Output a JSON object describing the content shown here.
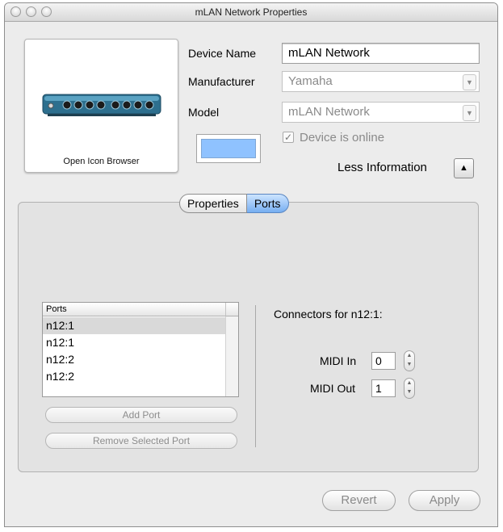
{
  "window": {
    "title": "mLAN Network Properties"
  },
  "icon_browser": {
    "caption": "Open Icon Browser",
    "icon": "mlan-device-icon"
  },
  "fields": {
    "device_name_label": "Device Name",
    "device_name_value": "mLAN Network",
    "manufacturer_label": "Manufacturer",
    "manufacturer_value": "Yamaha",
    "model_label": "Model",
    "model_value": "mLAN Network"
  },
  "color_swatch": {
    "color": "#8fc2ff"
  },
  "online": {
    "label": "Device is online",
    "checked": true
  },
  "less_info": {
    "label": "Less Information",
    "icon": "disclosure-up-icon"
  },
  "tabs": [
    {
      "label": "Properties",
      "selected": false
    },
    {
      "label": "Ports",
      "selected": true
    }
  ],
  "ports": {
    "header": "Ports",
    "rows": [
      "n12:1",
      "n12:1",
      "n12:2",
      "n12:2"
    ],
    "selected_index": 0,
    "add_button": "Add Port",
    "remove_button": "Remove Selected Port"
  },
  "connectors": {
    "title": "Connectors for n12:1:",
    "midi_in_label": "MIDI In",
    "midi_in_value": "0",
    "midi_out_label": "MIDI Out",
    "midi_out_value": "1"
  },
  "footer": {
    "revert": "Revert",
    "apply": "Apply"
  }
}
